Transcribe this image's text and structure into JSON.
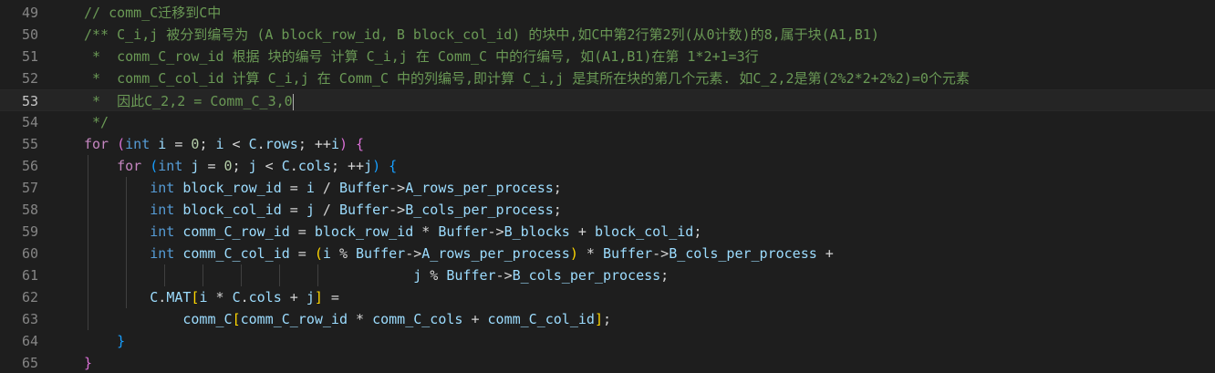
{
  "editor": {
    "theme": {
      "background": "#1e1e1e",
      "comment": "#6a9955",
      "keyword": "#569cd6",
      "control": "#c586c0",
      "variable": "#9cdcfe",
      "number": "#b5cea8",
      "bracket_1": "#da70d6",
      "bracket_2": "#179fff",
      "bracket_3": "#ffd700"
    },
    "current_line": "53",
    "lines": [
      {
        "number": "49",
        "tokens": [
          {
            "t": "// comm_C迁移到C中",
            "c": "cm"
          }
        ]
      },
      {
        "number": "50",
        "tokens": [
          {
            "t": "/** C_i,j 被分到编号为 (A block_row_id, B block_col_id) 的块中,如C中第2行第2列(从0计数)的8,属于块(A1,B1)",
            "c": "cm"
          }
        ]
      },
      {
        "number": "51",
        "tokens": [
          {
            "t": " *  comm_C_row_id 根据 块的编号 计算 C_i,j 在 Comm_C 中的行编号, 如(A1,B1)在第 1*2+1=3行",
            "c": "cm"
          }
        ]
      },
      {
        "number": "52",
        "tokens": [
          {
            "t": " *  comm_C_col_id 计算 C_i,j 在 Comm_C 中的列编号,即计算 C_i,j 是其所在块的第几个元素. 如C_2,2是第(2%2*2+2%2)=0个元素",
            "c": "cm"
          }
        ]
      },
      {
        "number": "53",
        "tokens": [
          {
            "t": " *  因此C_2,2 = Comm_C_3,0",
            "c": "cm"
          }
        ]
      },
      {
        "number": "54",
        "tokens": [
          {
            "t": " */",
            "c": "cm"
          }
        ]
      },
      {
        "number": "55",
        "tokens": [
          {
            "t": "for",
            "c": "ctl"
          },
          {
            "t": " ",
            "c": "pl"
          },
          {
            "t": "(",
            "c": "br1"
          },
          {
            "t": "int",
            "c": "kw"
          },
          {
            "t": " ",
            "c": "pl"
          },
          {
            "t": "i",
            "c": "var"
          },
          {
            "t": " = ",
            "c": "pl"
          },
          {
            "t": "0",
            "c": "num"
          },
          {
            "t": "; ",
            "c": "pl"
          },
          {
            "t": "i",
            "c": "var"
          },
          {
            "t": " < ",
            "c": "pl"
          },
          {
            "t": "C",
            "c": "var"
          },
          {
            "t": ".",
            "c": "pl"
          },
          {
            "t": "rows",
            "c": "var"
          },
          {
            "t": "; ++",
            "c": "pl"
          },
          {
            "t": "i",
            "c": "var"
          },
          {
            "t": ")",
            "c": "br1"
          },
          {
            "t": " ",
            "c": "pl"
          },
          {
            "t": "{",
            "c": "br1"
          }
        ]
      },
      {
        "number": "56",
        "tokens": [
          {
            "t": "    ",
            "c": "pl"
          },
          {
            "t": "for",
            "c": "ctl"
          },
          {
            "t": " ",
            "c": "pl"
          },
          {
            "t": "(",
            "c": "br2"
          },
          {
            "t": "int",
            "c": "kw"
          },
          {
            "t": " ",
            "c": "pl"
          },
          {
            "t": "j",
            "c": "var"
          },
          {
            "t": " = ",
            "c": "pl"
          },
          {
            "t": "0",
            "c": "num"
          },
          {
            "t": "; ",
            "c": "pl"
          },
          {
            "t": "j",
            "c": "var"
          },
          {
            "t": " < ",
            "c": "pl"
          },
          {
            "t": "C",
            "c": "var"
          },
          {
            "t": ".",
            "c": "pl"
          },
          {
            "t": "cols",
            "c": "var"
          },
          {
            "t": "; ++",
            "c": "pl"
          },
          {
            "t": "j",
            "c": "var"
          },
          {
            "t": ")",
            "c": "br2"
          },
          {
            "t": " ",
            "c": "pl"
          },
          {
            "t": "{",
            "c": "br2"
          }
        ]
      },
      {
        "number": "57",
        "tokens": [
          {
            "t": "        ",
            "c": "pl"
          },
          {
            "t": "int",
            "c": "kw"
          },
          {
            "t": " ",
            "c": "pl"
          },
          {
            "t": "block_row_id",
            "c": "var"
          },
          {
            "t": " = ",
            "c": "pl"
          },
          {
            "t": "i",
            "c": "var"
          },
          {
            "t": " / ",
            "c": "pl"
          },
          {
            "t": "Buffer",
            "c": "var"
          },
          {
            "t": "->",
            "c": "pl"
          },
          {
            "t": "A_rows_per_process",
            "c": "var"
          },
          {
            "t": ";",
            "c": "pl"
          }
        ]
      },
      {
        "number": "58",
        "tokens": [
          {
            "t": "        ",
            "c": "pl"
          },
          {
            "t": "int",
            "c": "kw"
          },
          {
            "t": " ",
            "c": "pl"
          },
          {
            "t": "block_col_id",
            "c": "var"
          },
          {
            "t": " = ",
            "c": "pl"
          },
          {
            "t": "j",
            "c": "var"
          },
          {
            "t": " / ",
            "c": "pl"
          },
          {
            "t": "Buffer",
            "c": "var"
          },
          {
            "t": "->",
            "c": "pl"
          },
          {
            "t": "B_cols_per_process",
            "c": "var"
          },
          {
            "t": ";",
            "c": "pl"
          }
        ]
      },
      {
        "number": "59",
        "tokens": [
          {
            "t": "        ",
            "c": "pl"
          },
          {
            "t": "int",
            "c": "kw"
          },
          {
            "t": " ",
            "c": "pl"
          },
          {
            "t": "comm_C_row_id",
            "c": "var"
          },
          {
            "t": " = ",
            "c": "pl"
          },
          {
            "t": "block_row_id",
            "c": "var"
          },
          {
            "t": " * ",
            "c": "pl"
          },
          {
            "t": "Buffer",
            "c": "var"
          },
          {
            "t": "->",
            "c": "pl"
          },
          {
            "t": "B_blocks",
            "c": "var"
          },
          {
            "t": " + ",
            "c": "pl"
          },
          {
            "t": "block_col_id",
            "c": "var"
          },
          {
            "t": ";",
            "c": "pl"
          }
        ]
      },
      {
        "number": "60",
        "tokens": [
          {
            "t": "        ",
            "c": "pl"
          },
          {
            "t": "int",
            "c": "kw"
          },
          {
            "t": " ",
            "c": "pl"
          },
          {
            "t": "comm_C_col_id",
            "c": "var"
          },
          {
            "t": " = ",
            "c": "pl"
          },
          {
            "t": "(",
            "c": "br3"
          },
          {
            "t": "i",
            "c": "var"
          },
          {
            "t": " % ",
            "c": "pl"
          },
          {
            "t": "Buffer",
            "c": "var"
          },
          {
            "t": "->",
            "c": "pl"
          },
          {
            "t": "A_rows_per_process",
            "c": "var"
          },
          {
            "t": ")",
            "c": "br3"
          },
          {
            "t": " * ",
            "c": "pl"
          },
          {
            "t": "Buffer",
            "c": "var"
          },
          {
            "t": "->",
            "c": "pl"
          },
          {
            "t": "B_cols_per_process",
            "c": "var"
          },
          {
            "t": " +",
            "c": "pl"
          }
        ]
      },
      {
        "number": "61",
        "tokens": [
          {
            "t": "                                        ",
            "c": "pl"
          },
          {
            "t": "j",
            "c": "var"
          },
          {
            "t": " % ",
            "c": "pl"
          },
          {
            "t": "Buffer",
            "c": "var"
          },
          {
            "t": "->",
            "c": "pl"
          },
          {
            "t": "B_cols_per_process",
            "c": "var"
          },
          {
            "t": ";",
            "c": "pl"
          }
        ]
      },
      {
        "number": "62",
        "tokens": [
          {
            "t": "        ",
            "c": "pl"
          },
          {
            "t": "C",
            "c": "var"
          },
          {
            "t": ".",
            "c": "pl"
          },
          {
            "t": "MAT",
            "c": "var"
          },
          {
            "t": "[",
            "c": "br3"
          },
          {
            "t": "i",
            "c": "var"
          },
          {
            "t": " * ",
            "c": "pl"
          },
          {
            "t": "C",
            "c": "var"
          },
          {
            "t": ".",
            "c": "pl"
          },
          {
            "t": "cols",
            "c": "var"
          },
          {
            "t": " + ",
            "c": "pl"
          },
          {
            "t": "j",
            "c": "var"
          },
          {
            "t": "]",
            "c": "br3"
          },
          {
            "t": " =",
            "c": "pl"
          }
        ]
      },
      {
        "number": "63",
        "tokens": [
          {
            "t": "            ",
            "c": "pl"
          },
          {
            "t": "comm_C",
            "c": "var"
          },
          {
            "t": "[",
            "c": "br3"
          },
          {
            "t": "comm_C_row_id",
            "c": "var"
          },
          {
            "t": " * ",
            "c": "pl"
          },
          {
            "t": "comm_C_cols",
            "c": "var"
          },
          {
            "t": " + ",
            "c": "pl"
          },
          {
            "t": "comm_C_col_id",
            "c": "var"
          },
          {
            "t": "]",
            "c": "br3"
          },
          {
            "t": ";",
            "c": "pl"
          }
        ]
      },
      {
        "number": "64",
        "tokens": [
          {
            "t": "    ",
            "c": "pl"
          },
          {
            "t": "}",
            "c": "br2"
          }
        ]
      },
      {
        "number": "65",
        "tokens": [
          {
            "t": "}",
            "c": "br1"
          }
        ]
      }
    ]
  }
}
